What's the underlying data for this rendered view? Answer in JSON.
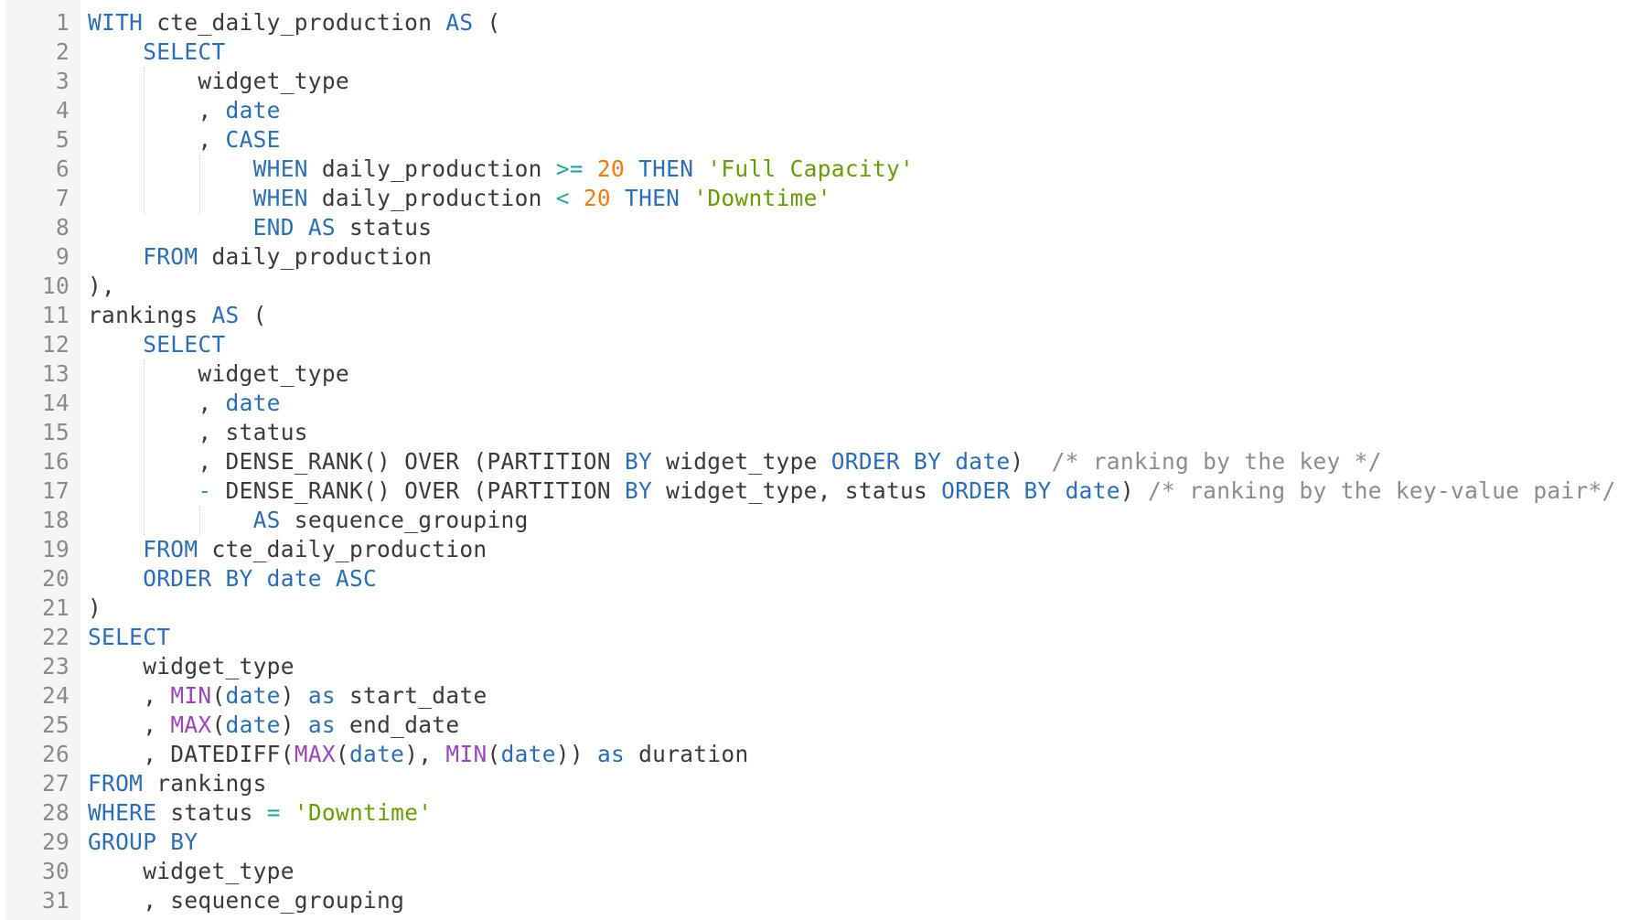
{
  "editor": {
    "language": "sql",
    "lines": [
      {
        "n": "1",
        "tokens": [
          [
            "kw",
            "WITH"
          ],
          [
            "pl",
            " cte_daily_production "
          ],
          [
            "kw",
            "AS"
          ],
          [
            "pl",
            " ("
          ]
        ]
      },
      {
        "n": "2",
        "tokens": [
          [
            "pl",
            "    "
          ],
          [
            "kw",
            "SELECT"
          ]
        ]
      },
      {
        "n": "3",
        "tokens": [
          [
            "pl",
            "        widget_type"
          ]
        ]
      },
      {
        "n": "4",
        "tokens": [
          [
            "pl",
            "        , "
          ],
          [
            "kw",
            "date"
          ]
        ]
      },
      {
        "n": "5",
        "tokens": [
          [
            "pl",
            "        , "
          ],
          [
            "kw",
            "CASE"
          ]
        ]
      },
      {
        "n": "6",
        "tokens": [
          [
            "pl",
            "            "
          ],
          [
            "kw",
            "WHEN"
          ],
          [
            "pl",
            " daily_production "
          ],
          [
            "op",
            ">="
          ],
          [
            "pl",
            " "
          ],
          [
            "num",
            "20"
          ],
          [
            "pl",
            " "
          ],
          [
            "kw",
            "THEN"
          ],
          [
            "pl",
            " "
          ],
          [
            "str",
            "'Full Capacity'"
          ]
        ]
      },
      {
        "n": "7",
        "tokens": [
          [
            "pl",
            "            "
          ],
          [
            "kw",
            "WHEN"
          ],
          [
            "pl",
            " daily_production "
          ],
          [
            "op",
            "<"
          ],
          [
            "pl",
            " "
          ],
          [
            "num",
            "20"
          ],
          [
            "pl",
            " "
          ],
          [
            "kw",
            "THEN"
          ],
          [
            "pl",
            " "
          ],
          [
            "str",
            "'Downtime'"
          ]
        ]
      },
      {
        "n": "8",
        "tokens": [
          [
            "pl",
            "            "
          ],
          [
            "kw",
            "END"
          ],
          [
            "pl",
            " "
          ],
          [
            "kw",
            "AS"
          ],
          [
            "pl",
            " status"
          ]
        ]
      },
      {
        "n": "9",
        "tokens": [
          [
            "pl",
            "    "
          ],
          [
            "kw",
            "FROM"
          ],
          [
            "pl",
            " daily_production"
          ]
        ]
      },
      {
        "n": "10",
        "tokens": [
          [
            "pl",
            "),"
          ]
        ]
      },
      {
        "n": "11",
        "tokens": [
          [
            "pl",
            "rankings "
          ],
          [
            "kw",
            "AS"
          ],
          [
            "pl",
            " ("
          ]
        ]
      },
      {
        "n": "12",
        "tokens": [
          [
            "pl",
            "    "
          ],
          [
            "kw",
            "SELECT"
          ]
        ]
      },
      {
        "n": "13",
        "tokens": [
          [
            "pl",
            "        widget_type"
          ]
        ]
      },
      {
        "n": "14",
        "tokens": [
          [
            "pl",
            "        , "
          ],
          [
            "kw",
            "date"
          ]
        ]
      },
      {
        "n": "15",
        "tokens": [
          [
            "pl",
            "        , status"
          ]
        ]
      },
      {
        "n": "16",
        "tokens": [
          [
            "pl",
            "        , DENSE_RANK() OVER (PARTITION "
          ],
          [
            "kw",
            "BY"
          ],
          [
            "pl",
            " widget_type "
          ],
          [
            "kw",
            "ORDER BY"
          ],
          [
            "pl",
            " "
          ],
          [
            "kw",
            "date"
          ],
          [
            "pl",
            ")  "
          ],
          [
            "cm",
            "/* ranking by the key */"
          ]
        ]
      },
      {
        "n": "17",
        "tokens": [
          [
            "pl",
            "        "
          ],
          [
            "op",
            "-"
          ],
          [
            "pl",
            " DENSE_RANK() OVER (PARTITION "
          ],
          [
            "kw",
            "BY"
          ],
          [
            "pl",
            " widget_type, status "
          ],
          [
            "kw",
            "ORDER BY"
          ],
          [
            "pl",
            " "
          ],
          [
            "kw",
            "date"
          ],
          [
            "pl",
            ") "
          ],
          [
            "cm",
            "/* ranking by the key-value pair*/"
          ]
        ]
      },
      {
        "n": "18",
        "tokens": [
          [
            "pl",
            "            "
          ],
          [
            "kw",
            "AS"
          ],
          [
            "pl",
            " sequence_grouping"
          ]
        ]
      },
      {
        "n": "19",
        "tokens": [
          [
            "pl",
            "    "
          ],
          [
            "kw",
            "FROM"
          ],
          [
            "pl",
            " cte_daily_production"
          ]
        ]
      },
      {
        "n": "20",
        "tokens": [
          [
            "pl",
            "    "
          ],
          [
            "kw",
            "ORDER BY date ASC"
          ]
        ]
      },
      {
        "n": "21",
        "tokens": [
          [
            "pl",
            ")"
          ]
        ]
      },
      {
        "n": "22",
        "tokens": [
          [
            "kw",
            "SELECT"
          ]
        ]
      },
      {
        "n": "23",
        "tokens": [
          [
            "pl",
            "    widget_type"
          ]
        ]
      },
      {
        "n": "24",
        "tokens": [
          [
            "pl",
            "    , "
          ],
          [
            "fn",
            "MIN"
          ],
          [
            "pl",
            "("
          ],
          [
            "kw",
            "date"
          ],
          [
            "pl",
            ") "
          ],
          [
            "kw",
            "as"
          ],
          [
            "pl",
            " start_date"
          ]
        ]
      },
      {
        "n": "25",
        "tokens": [
          [
            "pl",
            "    , "
          ],
          [
            "fn",
            "MAX"
          ],
          [
            "pl",
            "("
          ],
          [
            "kw",
            "date"
          ],
          [
            "pl",
            ") "
          ],
          [
            "kw",
            "as"
          ],
          [
            "pl",
            " end_date"
          ]
        ]
      },
      {
        "n": "26",
        "tokens": [
          [
            "pl",
            "    , DATEDIFF("
          ],
          [
            "fn",
            "MAX"
          ],
          [
            "pl",
            "("
          ],
          [
            "kw",
            "date"
          ],
          [
            "pl",
            "), "
          ],
          [
            "fn",
            "MIN"
          ],
          [
            "pl",
            "("
          ],
          [
            "kw",
            "date"
          ],
          [
            "pl",
            "))"
          ],
          [
            "pl",
            " "
          ],
          [
            "kw",
            "as"
          ],
          [
            "pl",
            " duration"
          ]
        ]
      },
      {
        "n": "27",
        "tokens": [
          [
            "kw",
            "FROM"
          ],
          [
            "pl",
            " rankings"
          ]
        ]
      },
      {
        "n": "28",
        "tokens": [
          [
            "kw",
            "WHERE"
          ],
          [
            "pl",
            " status "
          ],
          [
            "op",
            "="
          ],
          [
            "pl",
            " "
          ],
          [
            "str",
            "'Downtime'"
          ]
        ]
      },
      {
        "n": "29",
        "tokens": [
          [
            "kw",
            "GROUP BY"
          ]
        ]
      },
      {
        "n": "30",
        "tokens": [
          [
            "pl",
            "    widget_type"
          ]
        ]
      },
      {
        "n": "31",
        "tokens": [
          [
            "pl",
            "    , sequence_grouping"
          ]
        ]
      }
    ]
  }
}
